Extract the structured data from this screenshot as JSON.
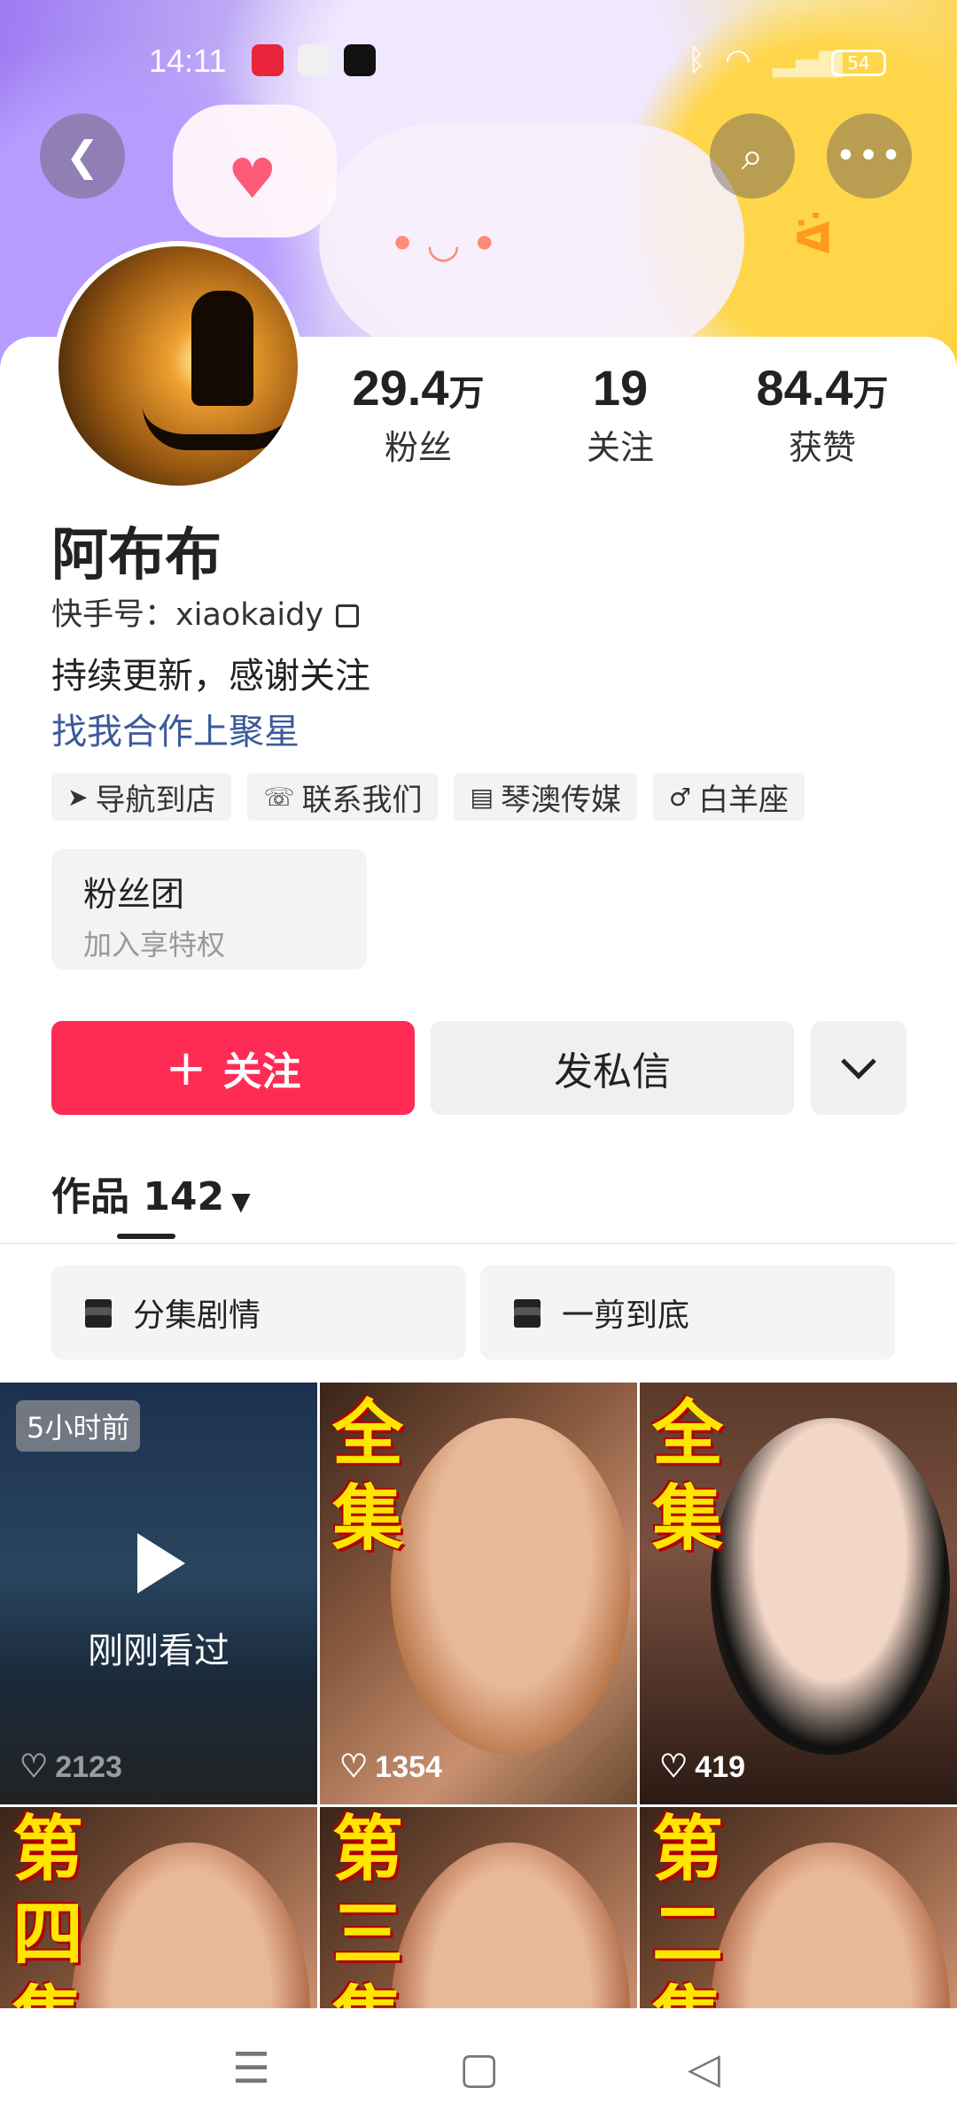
{
  "status_bar": {
    "time": "14:11",
    "battery": "54"
  },
  "profile": {
    "stats": [
      {
        "num": "29.4",
        "unit": "万",
        "label": "粉丝"
      },
      {
        "num": "19",
        "unit": "",
        "label": "关注"
      },
      {
        "num": "84.4",
        "unit": "万",
        "label": "获赞"
      }
    ],
    "name": "阿布布",
    "kuaishou_id": "快手号：xiaokaidy",
    "bio": "持续更新，感谢关注",
    "cooperation_link": "找我合作上聚星",
    "tags": [
      {
        "icon": "navigate-icon",
        "label": "导航到店"
      },
      {
        "icon": "phone-icon",
        "label": "联系我们"
      },
      {
        "icon": "company-icon",
        "label": "琴澳传媒"
      },
      {
        "icon": "male-icon",
        "label": "白羊座"
      }
    ],
    "fan_club": {
      "title": "粉丝团",
      "subtitle": "加入享特权"
    }
  },
  "actions": {
    "follow": "关注",
    "message": "发私信"
  },
  "works": {
    "label": "作品 142"
  },
  "collections": [
    "分集剧情",
    "一剪到底"
  ],
  "videos": [
    {
      "badge": "5小时前",
      "overlay": "刚刚看过",
      "likes": "2123"
    },
    {
      "title_chars": [
        "全",
        "集"
      ],
      "likes": "1354"
    },
    {
      "title_chars": [
        "全",
        "集"
      ],
      "likes": "419"
    },
    {
      "title_chars": [
        "第",
        "四",
        "集"
      ]
    },
    {
      "title_chars": [
        "第",
        "三",
        "集"
      ]
    },
    {
      "title_chars": [
        "第",
        "二",
        "集"
      ]
    }
  ],
  "colors": {
    "accent": "#fe2c55",
    "link": "#3c5a9a"
  }
}
